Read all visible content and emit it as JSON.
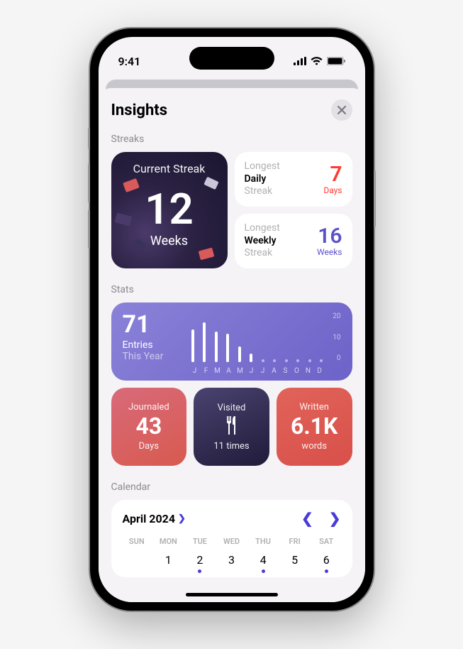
{
  "status": {
    "time": "9:41"
  },
  "sheet": {
    "title": "Insights"
  },
  "sections": {
    "streaks": "Streaks",
    "stats": "Stats",
    "calendar": "Calendar"
  },
  "current_streak": {
    "title": "Current Streak",
    "value": "12",
    "unit": "Weeks"
  },
  "longest_daily": {
    "l1": "Longest",
    "l2": "Daily",
    "l3": "Streak",
    "value": "7",
    "unit": "Days"
  },
  "longest_weekly": {
    "l1": "Longest",
    "l2": "Weekly",
    "l3": "Streak",
    "value": "16",
    "unit": "Weeks"
  },
  "entries": {
    "value": "71",
    "label1": "Entries",
    "label2": "This Year"
  },
  "chart_data": {
    "type": "bar",
    "categories": [
      "J",
      "F",
      "M",
      "A",
      "M",
      "J",
      "J",
      "A",
      "S",
      "O",
      "N",
      "D"
    ],
    "values": [
      15,
      18,
      14,
      13,
      7,
      4,
      0,
      0,
      0,
      0,
      0,
      0
    ],
    "ylim": [
      0,
      20
    ],
    "yticks": [
      20,
      10,
      0
    ]
  },
  "journaled": {
    "top": "Journaled",
    "value": "43",
    "unit": "Days"
  },
  "visited": {
    "top": "Visited",
    "value": "11 times"
  },
  "written": {
    "top": "Written",
    "value": "6.1K",
    "unit": "words"
  },
  "calendar": {
    "month": "April 2024",
    "dow": [
      "SUN",
      "MON",
      "TUE",
      "WED",
      "THU",
      "FRI",
      "SAT"
    ],
    "leading_blanks": 1,
    "days": [
      {
        "n": 1,
        "dot": false
      },
      {
        "n": 2,
        "dot": true
      },
      {
        "n": 3,
        "dot": false
      },
      {
        "n": 4,
        "dot": true
      },
      {
        "n": 5,
        "dot": false
      },
      {
        "n": 6,
        "dot": true
      }
    ]
  }
}
